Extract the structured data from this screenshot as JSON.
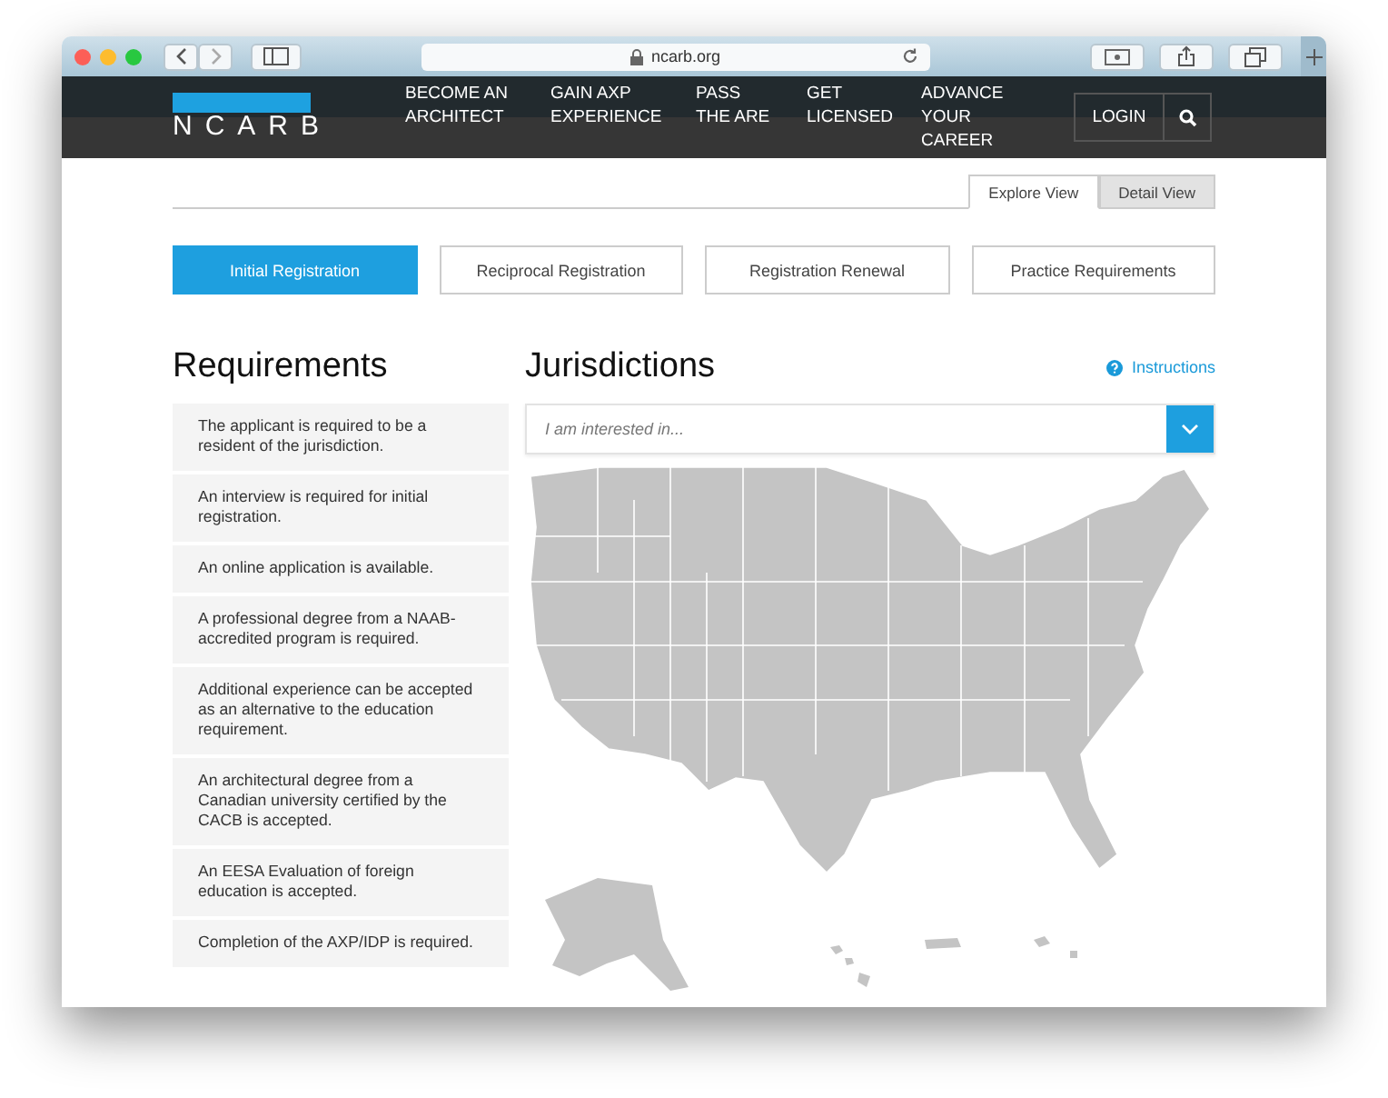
{
  "browser": {
    "url": "ncarb.org"
  },
  "nav": {
    "logo": "NCARB",
    "items": [
      {
        "label": "BECOME AN ARCHITECT"
      },
      {
        "label": "GAIN AXP EXPERIENCE"
      },
      {
        "label": "PASS THE ARE"
      },
      {
        "label": "GET LICENSED"
      },
      {
        "label": "ADVANCE YOUR CAREER"
      }
    ],
    "login": "LOGIN"
  },
  "view_tabs": [
    {
      "label": "Explore View",
      "selected": true
    },
    {
      "label": "Detail View",
      "selected": false
    }
  ],
  "categories": [
    {
      "label": "Initial Registration",
      "selected": true
    },
    {
      "label": "Reciprocal Registration",
      "selected": false
    },
    {
      "label": "Registration Renewal",
      "selected": false
    },
    {
      "label": "Practice Requirements",
      "selected": false
    }
  ],
  "requirements": {
    "title": "Requirements",
    "items": [
      "The applicant is required to be a resident of the jurisdiction.",
      "An interview is required for initial registration.",
      "An online application is available.",
      "A professional degree from a NAAB-accredited program is required.",
      "Additional experience can be accepted as an alternative to the education requirement.",
      "An architectural degree from a Canadian university certified by the CACB is accepted.",
      "An EESA Evaluation of foreign education is accepted.",
      "Completion of the AXP/IDP is required."
    ]
  },
  "jurisdictions": {
    "title": "Jurisdictions",
    "instructions": "Instructions",
    "dropdown": {
      "placeholder": "I am interested in..."
    }
  }
}
